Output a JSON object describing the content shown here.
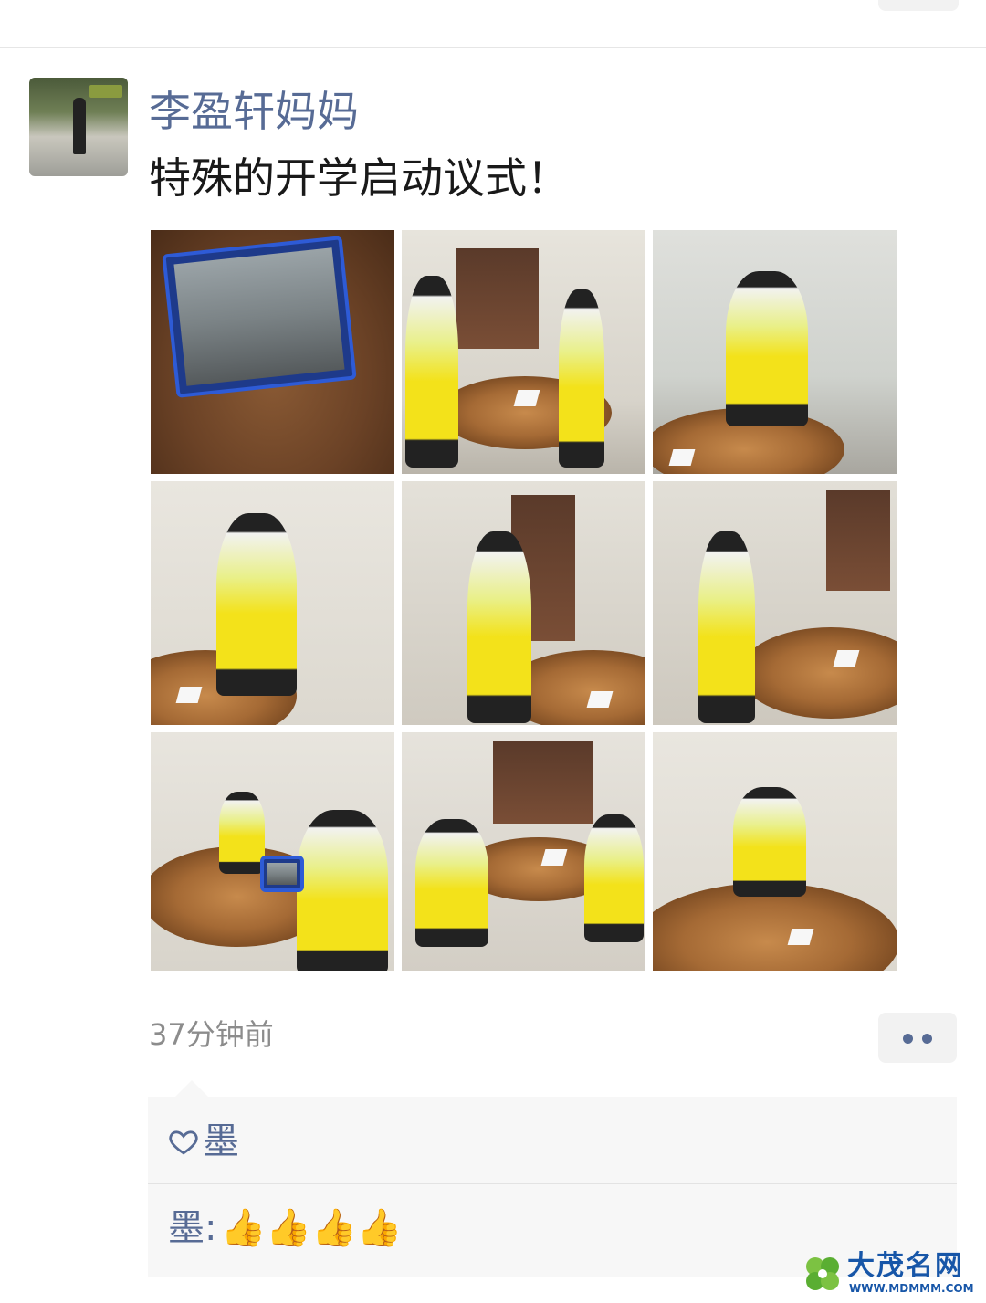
{
  "post": {
    "author": "李盈轩妈妈",
    "text": "特殊的开学启动议式！",
    "time": "37分钟前",
    "photos": [
      "tablet-showing-ceremony",
      "two-students-saluting-at-table",
      "boy-saluting-by-table",
      "girl-saluting-in-corner",
      "girl-saluting-by-cabinet",
      "boy-saluting-beside-table",
      "students-watching-tablet",
      "two-students-seated-at-table",
      "girl-seated-at-table"
    ]
  },
  "interactions": {
    "likes": [
      "墨"
    ],
    "comments": [
      {
        "name": "墨",
        "separator": ":",
        "text": "👍👍👍👍"
      }
    ]
  },
  "watermark": {
    "title": "大茂名网",
    "url": "WWW.MDMMM.COM"
  },
  "colors": {
    "link": "#576b95",
    "text": "#191919",
    "meta": "#8c8c8c",
    "panel": "#f7f7f7"
  }
}
